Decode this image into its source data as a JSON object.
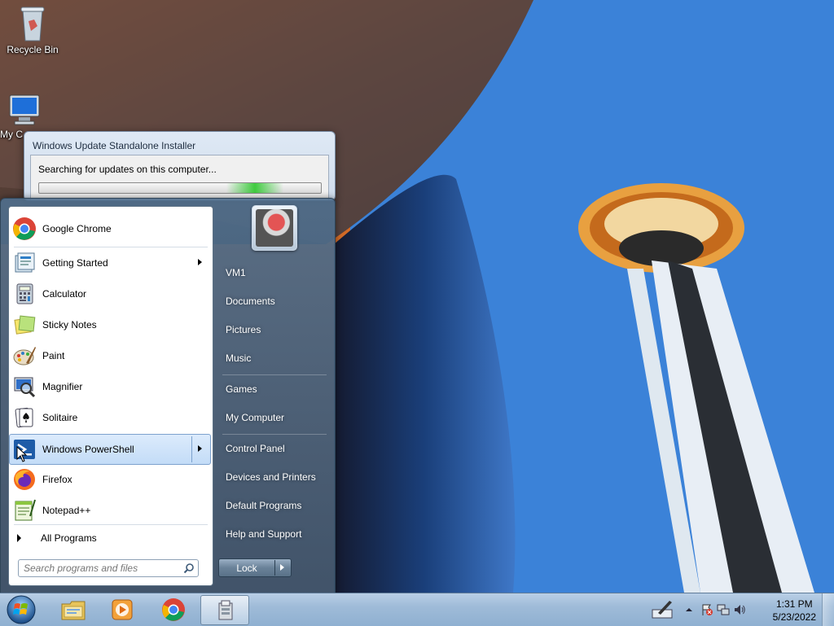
{
  "desktop": {
    "icons": [
      {
        "label": "Recycle Bin",
        "icon": "recycle-bin-icon"
      },
      {
        "label": "My C",
        "icon": "my-computer-icon"
      }
    ]
  },
  "update_window": {
    "title": "Windows Update Standalone Installer",
    "status": "Searching for updates on this computer...",
    "progress_mode": "indeterminate"
  },
  "start_menu": {
    "programs": [
      {
        "label": "Google Chrome",
        "icon": "chrome-icon",
        "submenu": false
      },
      {
        "label": "Getting Started",
        "icon": "getting-started-icon",
        "submenu": true
      },
      {
        "label": "Calculator",
        "icon": "calculator-icon",
        "submenu": false
      },
      {
        "label": "Sticky Notes",
        "icon": "sticky-notes-icon",
        "submenu": false
      },
      {
        "label": "Paint",
        "icon": "paint-icon",
        "submenu": false
      },
      {
        "label": "Magnifier",
        "icon": "magnifier-icon",
        "submenu": false
      },
      {
        "label": "Solitaire",
        "icon": "solitaire-icon",
        "submenu": false
      },
      {
        "label": "Windows PowerShell",
        "icon": "powershell-icon",
        "submenu": true,
        "highlighted": true
      },
      {
        "label": "Firefox",
        "icon": "firefox-icon",
        "submenu": false
      },
      {
        "label": "Notepad++",
        "icon": "notepadpp-icon",
        "submenu": false
      }
    ],
    "all_programs": "All Programs",
    "search_placeholder": "Search programs and files",
    "user_name": "VM1",
    "places": [
      {
        "label": "Documents"
      },
      {
        "label": "Pictures"
      },
      {
        "label": "Music"
      },
      {
        "label": "Games"
      },
      {
        "label": "My Computer"
      },
      {
        "label": "Control Panel"
      },
      {
        "label": "Devices and Printers"
      },
      {
        "label": "Default Programs"
      },
      {
        "label": "Help and Support"
      }
    ],
    "lock_label": "Lock"
  },
  "taskbar": {
    "pinned": [
      {
        "name": "explorer",
        "icon": "explorer-folder-icon"
      },
      {
        "name": "media-player",
        "icon": "media-player-icon"
      },
      {
        "name": "chrome",
        "icon": "chrome-icon"
      },
      {
        "name": "update-installer",
        "icon": "installer-icon",
        "active": true
      }
    ],
    "clock": {
      "time": "1:31 PM",
      "date": "5/23/2022"
    }
  },
  "colors": {
    "highlight": "#c3dcf7",
    "progress": "#3fcb3f"
  }
}
